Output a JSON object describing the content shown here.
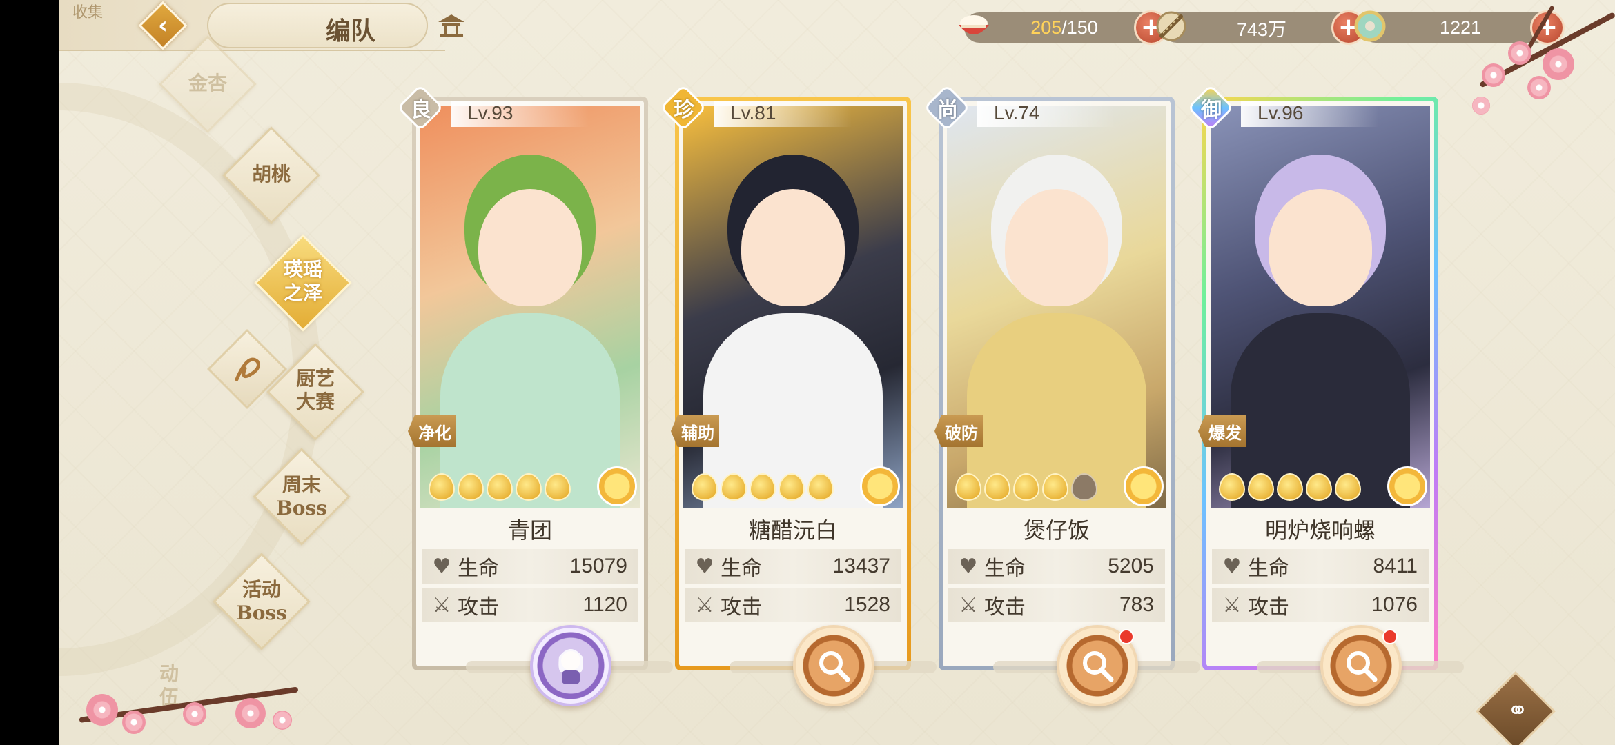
{
  "header": {
    "corner_text": "收集",
    "title": "编队"
  },
  "resources": {
    "stamina": {
      "current": "205",
      "max": "/150",
      "icon": "rice-bowl-icon"
    },
    "coin": {
      "value": "743万",
      "icon": "coin-string-icon"
    },
    "gem": {
      "value": "1221",
      "icon": "jade-icon"
    },
    "plus": "+"
  },
  "menu": {
    "items": [
      {
        "label": "金杏",
        "state": "faded"
      },
      {
        "label": "胡桃",
        "state": "normal"
      },
      {
        "label": "瑛瑶\n之泽",
        "state": "active"
      },
      {
        "label": "厨艺\n大赛",
        "state": "normal"
      },
      {
        "label": "周末\nBoss",
        "state": "normal"
      },
      {
        "label": "活动\nBoss",
        "state": "normal"
      },
      {
        "label": "动\n伍",
        "state": "faded"
      }
    ]
  },
  "cards": [
    {
      "rarity": "良",
      "level": "Lv.93",
      "role": "净化",
      "name": "青团",
      "stars": 5,
      "hp_label": "生命",
      "hp": "15079",
      "atk_label": "攻击",
      "atk": "1120",
      "equip": "avatar",
      "badge": false
    },
    {
      "rarity": "珍",
      "level": "Lv.81",
      "role": "辅助",
      "name": "糖醋沅白",
      "stars": 5,
      "hp_label": "生命",
      "hp": "13437",
      "atk_label": "攻击",
      "atk": "1528",
      "equip": "search",
      "badge": false
    },
    {
      "rarity": "尚",
      "level": "Lv.74",
      "role": "破防",
      "name": "煲仔饭",
      "stars": 4,
      "hp_label": "生命",
      "hp": "5205",
      "atk_label": "攻击",
      "atk": "783",
      "equip": "search",
      "badge": true
    },
    {
      "rarity": "御",
      "level": "Lv.96",
      "role": "爆发",
      "name": "明炉烧响螺",
      "stars": 5,
      "hp_label": "生命",
      "hp": "8411",
      "atk_label": "攻击",
      "atk": "1076",
      "equip": "search",
      "badge": true
    }
  ],
  "colors": {
    "accent_gold": "#e3ad35",
    "plus_red": "#c9553a",
    "text_brown": "#6b5233"
  }
}
